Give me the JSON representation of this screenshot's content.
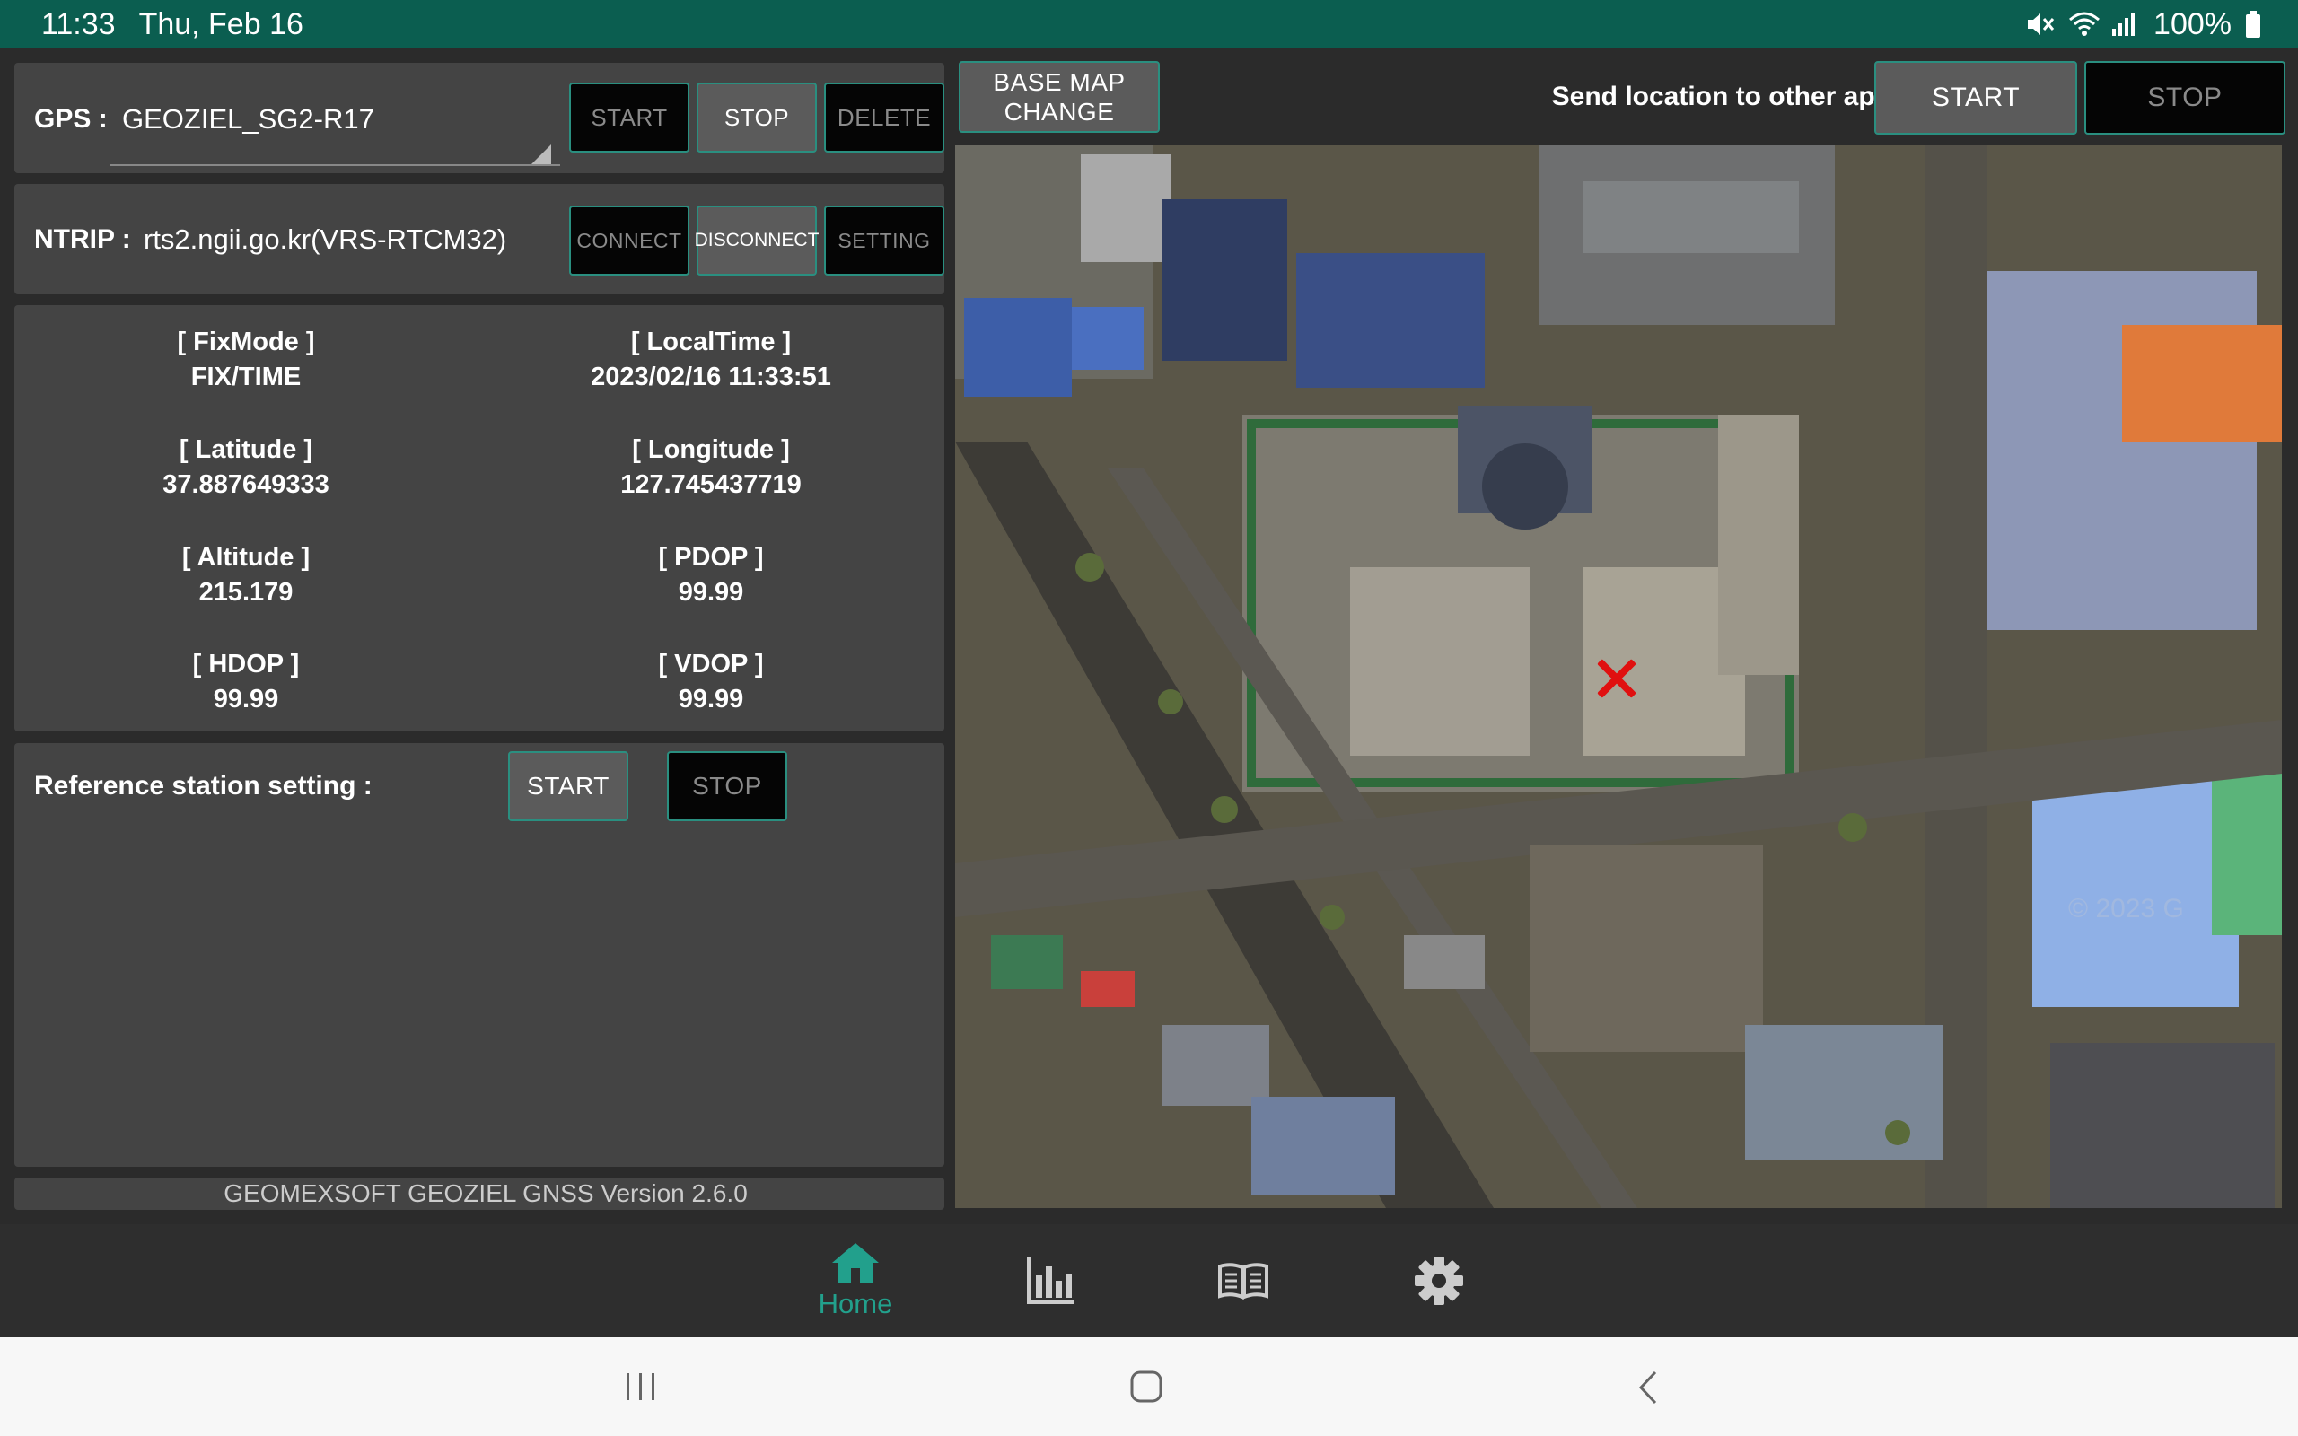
{
  "status_bar": {
    "time": "11:33",
    "date": "Thu, Feb 16",
    "battery": "100%",
    "icons": [
      "mute-icon",
      "wifi-icon",
      "signal-icon",
      "battery-icon"
    ]
  },
  "gps": {
    "label": "GPS :",
    "device": "GEOZIEL_SG2-R17",
    "buttons": {
      "start": "START",
      "stop": "STOP",
      "delete": "DELETE"
    }
  },
  "ntrip": {
    "label": "NTRIP :",
    "server": "rts2.ngii.go.kr(VRS-RTCM32)",
    "buttons": {
      "connect": "CONNECT",
      "disconnect": "DISCONNECT",
      "setting": "SETTING"
    }
  },
  "info": {
    "fixmode_label": "[ FixMode ]",
    "fixmode_value": "FIX/TIME",
    "localtime_label": "[ LocalTime ]",
    "localtime_value": "2023/02/16 11:33:51",
    "latitude_label": "[ Latitude ]",
    "latitude_value": "37.887649333",
    "longitude_label": "[ Longitude ]",
    "longitude_value": "127.745437719",
    "altitude_label": "[ Altitude ]",
    "altitude_value": "215.179",
    "pdop_label": "[ PDOP ]",
    "pdop_value": "99.99",
    "hdop_label": "[ HDOP ]",
    "hdop_value": "99.99",
    "vdop_label": "[ VDOP ]",
    "vdop_value": "99.99"
  },
  "reference": {
    "label": "Reference station setting :",
    "start": "START",
    "stop": "STOP"
  },
  "version": "GEOMEXSOFT GEOZIEL GNSS Version 2.6.0",
  "map": {
    "base_map_change": "BASE MAP\nCHANGE",
    "send_label": "Send location to other apps :",
    "send_start": "START",
    "send_stop": "STOP",
    "watermark": "© 2023 G",
    "marker_color": "#e01010"
  },
  "bottom_nav": {
    "home": "Home",
    "active_color": "#22a08c",
    "items": [
      "home-icon",
      "chart-icon",
      "book-icon",
      "gear-icon"
    ]
  },
  "colors": {
    "status_bar": "#0b5e50",
    "panel": "#444444",
    "accent_border": "#2a8f80"
  }
}
